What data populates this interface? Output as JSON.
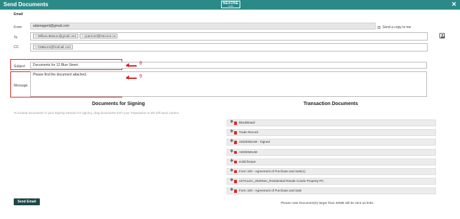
{
  "header": {
    "title": "Send Documents",
    "logo_text": "NEXONE",
    "logo_sub": "LOGO",
    "close_glyph": "✕",
    "color": "#2b8a87"
  },
  "email": {
    "section_label": "Email",
    "from_label": "From",
    "from_value": "adamagent@gmail.com",
    "to_label": "To",
    "to_recipients": [
      "WilliamJMason@gmail.com",
      "cpamorel@Nexone.ca"
    ],
    "cc_label": "CC",
    "cc_recipients": [
      "CMBurns@hotmail.com"
    ],
    "send_copy_label": "Send a copy to me",
    "subject_label": "Subject",
    "subject_value": "Documents for 12 Blue Street",
    "message_label": "Message",
    "message_value": "Please find the document attached."
  },
  "annotations": {
    "subject_number": "8",
    "message_number": "9",
    "color": "#d62828"
  },
  "signing": {
    "heading": "Documents for Signing",
    "hint": "To include documents in your Signing Session for signing, drag documents from your Transaction to the left hand column."
  },
  "transaction": {
    "heading": "Transaction Documents",
    "documents": [
      "BlackBoard",
      "Trade Record",
      "ADDENDUM - Signed",
      "ADDENDUM",
      "voidCheque",
      "Form 100 - Agreement of Purchase and Sale(1)",
      "1STCLDA_2020Nov_Residential Resale Condo Property PC",
      "Form 100 - Agreement of Purchase and Sale"
    ]
  },
  "footer": {
    "send_button": "Send Email",
    "note": "Please note Document(s) larger than 20MB will be sent as links",
    "button_color": "#1f4747"
  }
}
